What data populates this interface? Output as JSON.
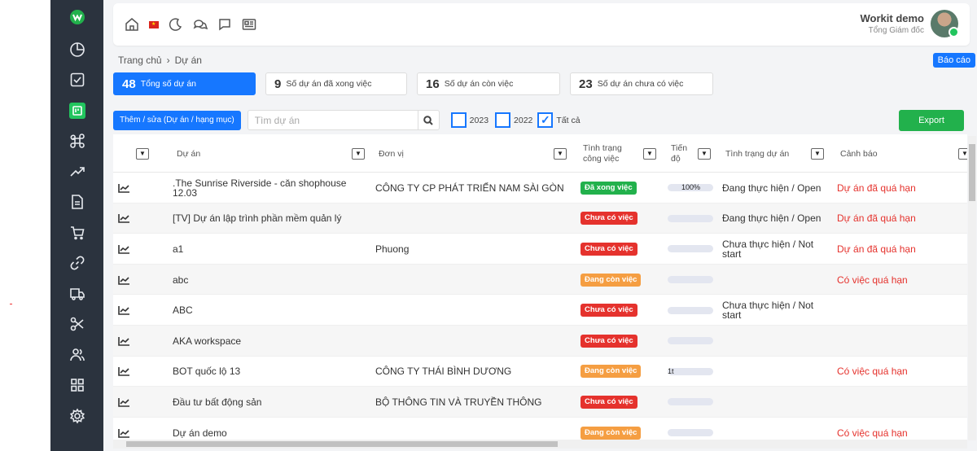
{
  "header": {
    "user_name": "Workit demo",
    "user_role": "Tổng Giám đốc"
  },
  "breadcrumb": {
    "home": "Trang chủ",
    "sep": "›",
    "current": "Dự án"
  },
  "report_button": "Báo cáo",
  "stats": [
    {
      "count": "48",
      "label": "Tổng số dự án"
    },
    {
      "count": "9",
      "label": "Số dự án đã xong việc"
    },
    {
      "count": "16",
      "label": "Số dự án còn việc"
    },
    {
      "count": "23",
      "label": "Số dự án chưa có việc"
    }
  ],
  "toolbar": {
    "add_label": "Thêm / sửa (Dự án / hạng mục)",
    "search_placeholder": "Tìm dự án",
    "year1": "2023",
    "year2": "2022",
    "all": "Tất cả",
    "export": "Export"
  },
  "columns": {
    "project": "Dự án",
    "unit": "Đơn vị",
    "status_line1": "Tình trạng",
    "status_line2": "công việc",
    "progress_line1": "Tiến",
    "progress_line2": "độ",
    "project_status": "Tình trạng dự án",
    "warning": "Cảnh báo"
  },
  "colors": {
    "done": "#22b14c",
    "none": "#e5322d",
    "ongoing": "#f59e42",
    "accent": "#1677ff"
  },
  "rows": [
    {
      "name": ".The Sunrise Riverside - căn shophouse 12.03",
      "unit": "CÔNG TY CP PHÁT TRIỂN NAM SÀI GÒN",
      "status": "Đã xong việc",
      "status_type": "done",
      "progress": "100%",
      "progress_value": 100,
      "project_status": "Đang thực hiện / Open",
      "warning": "Dự án đã quá hạn"
    },
    {
      "name": "[TV] Dự án lập trình phần mềm quản lý",
      "unit": "",
      "status": "Chưa có việc",
      "status_type": "none",
      "progress": "",
      "progress_value": 0,
      "project_status": "Đang thực hiện / Open",
      "warning": "Dự án đã quá hạn"
    },
    {
      "name": "a1",
      "unit": "Phuong",
      "status": "Chưa có việc",
      "status_type": "none",
      "progress": "",
      "progress_value": 0,
      "project_status": "Chưa thực hiện / Not start",
      "warning": "Dự án đã quá hạn"
    },
    {
      "name": "abc",
      "unit": "",
      "status": "Đang còn việc",
      "status_type": "ongoing",
      "progress": "",
      "progress_value": 0,
      "project_status": "",
      "warning": "Có việc quá hạn"
    },
    {
      "name": "ABC",
      "unit": "",
      "status": "Chưa có việc",
      "status_type": "none",
      "progress": "",
      "progress_value": 0,
      "project_status": "Chưa thực hiện / Not start",
      "warning": ""
    },
    {
      "name": "AKA workspace",
      "unit": "",
      "status": "Chưa có việc",
      "status_type": "none",
      "progress": "",
      "progress_value": 0,
      "project_status": "",
      "warning": ""
    },
    {
      "name": "BOT quốc lộ 13",
      "unit": "CÔNG TY THÁI BÌNH DƯƠNG",
      "status": "Đang còn việc",
      "status_type": "ongoing",
      "progress": "1t",
      "progress_value": 0,
      "project_status": "",
      "warning": "Có việc quá hạn"
    },
    {
      "name": "Đầu tư bất động sản",
      "unit": "BỘ THÔNG TIN VÀ TRUYỀN THÔNG",
      "status": "Chưa có việc",
      "status_type": "none",
      "progress": "",
      "progress_value": 0,
      "project_status": "",
      "warning": ""
    },
    {
      "name": "Dự án demo",
      "unit": "",
      "status": "Đang còn việc",
      "status_type": "ongoing",
      "progress": "",
      "progress_value": 0,
      "project_status": "",
      "warning": "Có việc quá hạn"
    }
  ]
}
